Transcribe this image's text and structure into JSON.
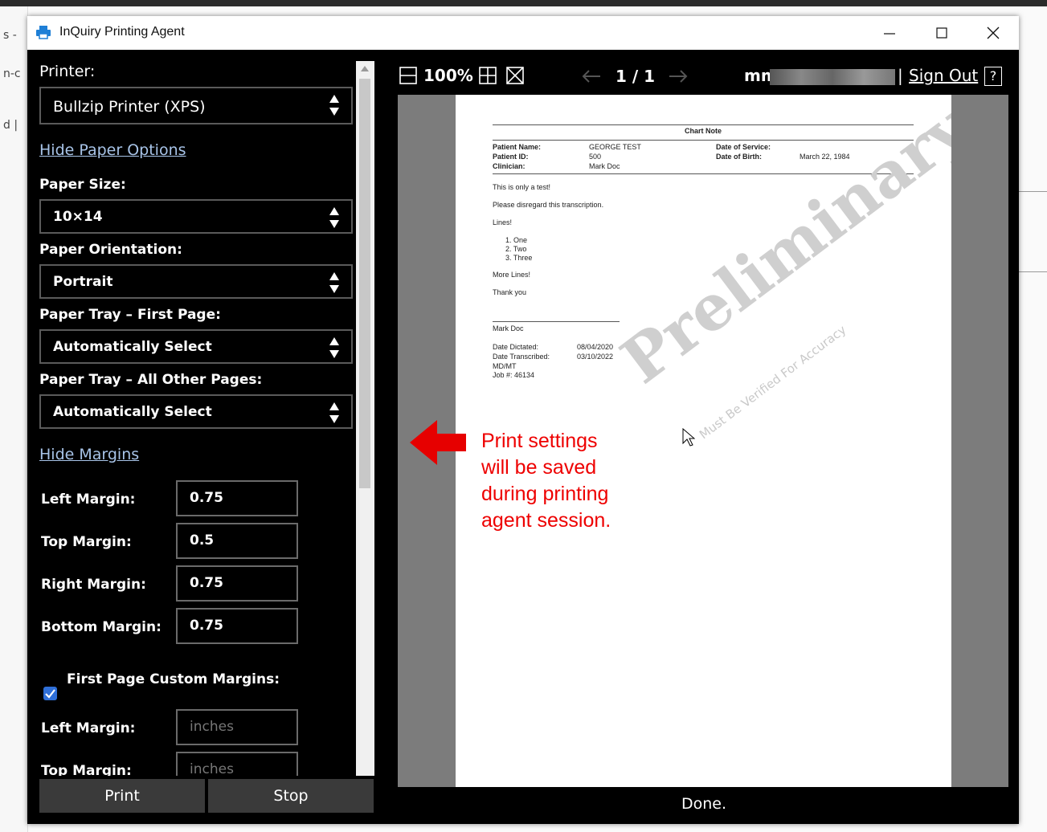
{
  "window": {
    "title": "InQuiry Printing Agent"
  },
  "sidebar": {
    "printer_label": "Printer:",
    "printer_value": "Bullzip Printer (XPS)",
    "hide_paper_options": "Hide Paper Options",
    "paper_size_label": "Paper Size:",
    "paper_size_value": "10×14",
    "orientation_label": "Paper Orientation:",
    "orientation_value": "Portrait",
    "tray_first_label": "Paper Tray – First Page:",
    "tray_first_value": "Automatically Select",
    "tray_other_label": "Paper Tray – All Other Pages:",
    "tray_other_value": "Automatically Select",
    "hide_margins": "Hide Margins",
    "margins": [
      {
        "label": "Left Margin:",
        "value": "0.75"
      },
      {
        "label": "Top Margin:",
        "value": "0.5"
      },
      {
        "label": "Right Margin:",
        "value": "0.75"
      },
      {
        "label": "Bottom Margin:",
        "value": "0.75"
      }
    ],
    "first_page_custom_label": "First Page Custom Margins:",
    "first_page_custom_checked": true,
    "first_page_margins": [
      {
        "label": "Left Margin:",
        "placeholder": "inches"
      },
      {
        "label": "Top Margin:",
        "placeholder": "inches"
      }
    ],
    "print_button": "Print",
    "stop_button": "Stop"
  },
  "preview": {
    "zoom": "100%",
    "page_indicator": "1 / 1",
    "user": "mm",
    "separator": "|",
    "sign_out": "Sign Out",
    "help": "?",
    "status": "Done."
  },
  "document": {
    "heading": "Chart Note",
    "patient_name_label": "Patient Name:",
    "patient_name": "GEORGE TEST",
    "patient_id_label": "Patient ID:",
    "patient_id": "500",
    "clinician_label": "Clinician:",
    "clinician": "Mark Doc",
    "date_of_service_label": "Date of Service:",
    "date_of_birth_label": "Date of Birth:",
    "date_of_birth": "March 22, 1984",
    "line1": "This is only a test!",
    "line2": "Please disregard this transcription.",
    "line3": "Lines!",
    "list": [
      "1.  One",
      "2.  Two",
      "3.  Three"
    ],
    "line4": "More Lines!",
    "line5": "Thank you",
    "signature": "Mark Doc",
    "dictated_label": "Date Dictated:",
    "dictated": "08/04/2020",
    "transcribed_label": "Date Transcribed:",
    "transcribed": "03/10/2022",
    "initials": "MD/MT",
    "job": "Job #: 46134",
    "watermark": "Preliminary",
    "watermark_sub": "Must Be Verified For Accuracy"
  },
  "annotation": {
    "line1": "Print settings",
    "line2": "will be saved",
    "line3": "during printing",
    "line4": "agent session.",
    "color": "#e00000"
  }
}
